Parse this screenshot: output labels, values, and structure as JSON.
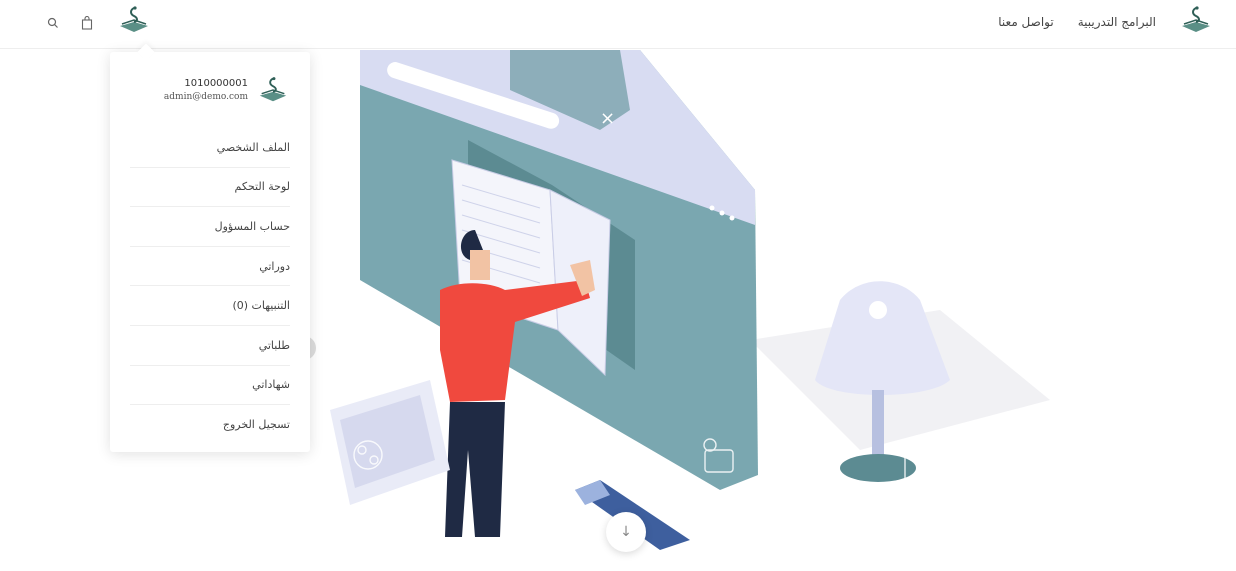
{
  "header": {
    "nav": [
      "البرامج التدريبية",
      "تواصل معنا"
    ],
    "icons": [
      "search-icon",
      "bag-icon"
    ]
  },
  "dropdown": {
    "phone": "1010000001",
    "email": "admin@demo.com",
    "items": [
      "الملف الشخصي",
      "لوحة التحكم",
      "حساب المسؤول",
      "دوراتي",
      "التنبيهات (0)",
      "طلباتي",
      "شهاداتي",
      "تسجيل الخروج"
    ]
  },
  "scroll_down": "↓",
  "colors": {
    "accent_red": "#f0493e",
    "panel_teal": "#7aa7b0",
    "lavender": "#d9dcf4"
  }
}
